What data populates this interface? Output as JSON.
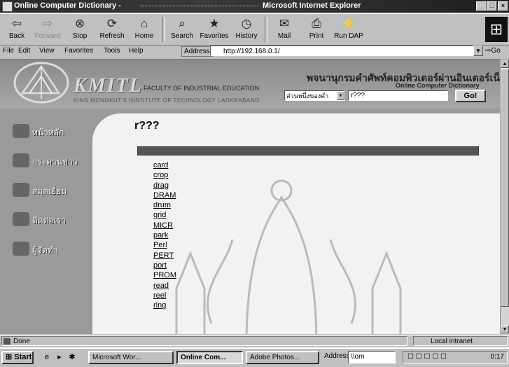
{
  "window": {
    "title_left": "Online Computer Dictionary -",
    "title_right": "Microsoft Internet Explorer",
    "controls": [
      "_",
      "□",
      "×"
    ]
  },
  "toolbar": {
    "buttons": [
      {
        "label": "Back",
        "icon": "back-arrow-icon",
        "glyph": "⇦"
      },
      {
        "label": "Forward",
        "icon": "forward-arrow-icon",
        "glyph": "⇨"
      },
      {
        "label": "Stop",
        "icon": "stop-icon",
        "glyph": "⊗"
      },
      {
        "label": "Refresh",
        "icon": "refresh-icon",
        "glyph": "⟳"
      },
      {
        "label": "Home",
        "icon": "home-icon",
        "glyph": "⌂"
      },
      {
        "label": "Search",
        "icon": "search-icon",
        "glyph": "⌕"
      },
      {
        "label": "Favorites",
        "icon": "favorites-icon",
        "glyph": "★"
      },
      {
        "label": "History",
        "icon": "history-icon",
        "glyph": "◷"
      },
      {
        "label": "Mail",
        "icon": "mail-icon",
        "glyph": "✉"
      },
      {
        "label": "Print",
        "icon": "print-icon",
        "glyph": "⎙"
      },
      {
        "label": "Run DAP",
        "icon": "run-dap-icon",
        "glyph": "⚡"
      }
    ]
  },
  "menu": {
    "items": [
      "File",
      "Edit",
      "View",
      "Favorites",
      "Tools",
      "Help"
    ],
    "address_label": "Address",
    "address_value": "http://192.168.0.1/",
    "go_label": "Go"
  },
  "page": {
    "brand": "KMITL",
    "faculty": "FACULTY OF INDUSTRIAL EDUCATION",
    "institute": "KING MONGKUT'S INSTITUTE OF TECHNOLOGY LADKRABANG",
    "thai_title": "พจนานุกรมคำศัพท์คอมพิวเตอร์ผ่านอินเตอร์เน็ต",
    "eng_title": "Online Computer Dictionary",
    "search_mode": "ส่วนหนึ่งของคำ",
    "search_value": "r???",
    "go_button": "Go!",
    "sidebar": [
      {
        "label": "หน้าหลัก",
        "icon": "home-icon"
      },
      {
        "label": "กระดานข่าว",
        "icon": "board-icon"
      },
      {
        "label": "สมุดเยี่ยม",
        "icon": "guestbook-icon"
      },
      {
        "label": "ติดต่อเรา",
        "icon": "contact-icon"
      },
      {
        "label": "ผู้จัดทำ",
        "icon": "authors-icon"
      }
    ],
    "result_title": "r???",
    "results": [
      "card",
      "crop",
      "drag",
      "DRAM",
      "drum",
      "grid",
      "MICR",
      "park",
      "Perl",
      "PERT",
      "port",
      "PROM",
      "read",
      "reel",
      "ring"
    ]
  },
  "status": {
    "text": "Done",
    "zone": "Local intranet"
  },
  "taskbar": {
    "start": "Start",
    "tasks": [
      "Microsoft Wor...",
      "Online Com...",
      "Adobe Photos..."
    ],
    "address_label": "Address",
    "address_value": "\\\\om",
    "clock": "0:17"
  }
}
